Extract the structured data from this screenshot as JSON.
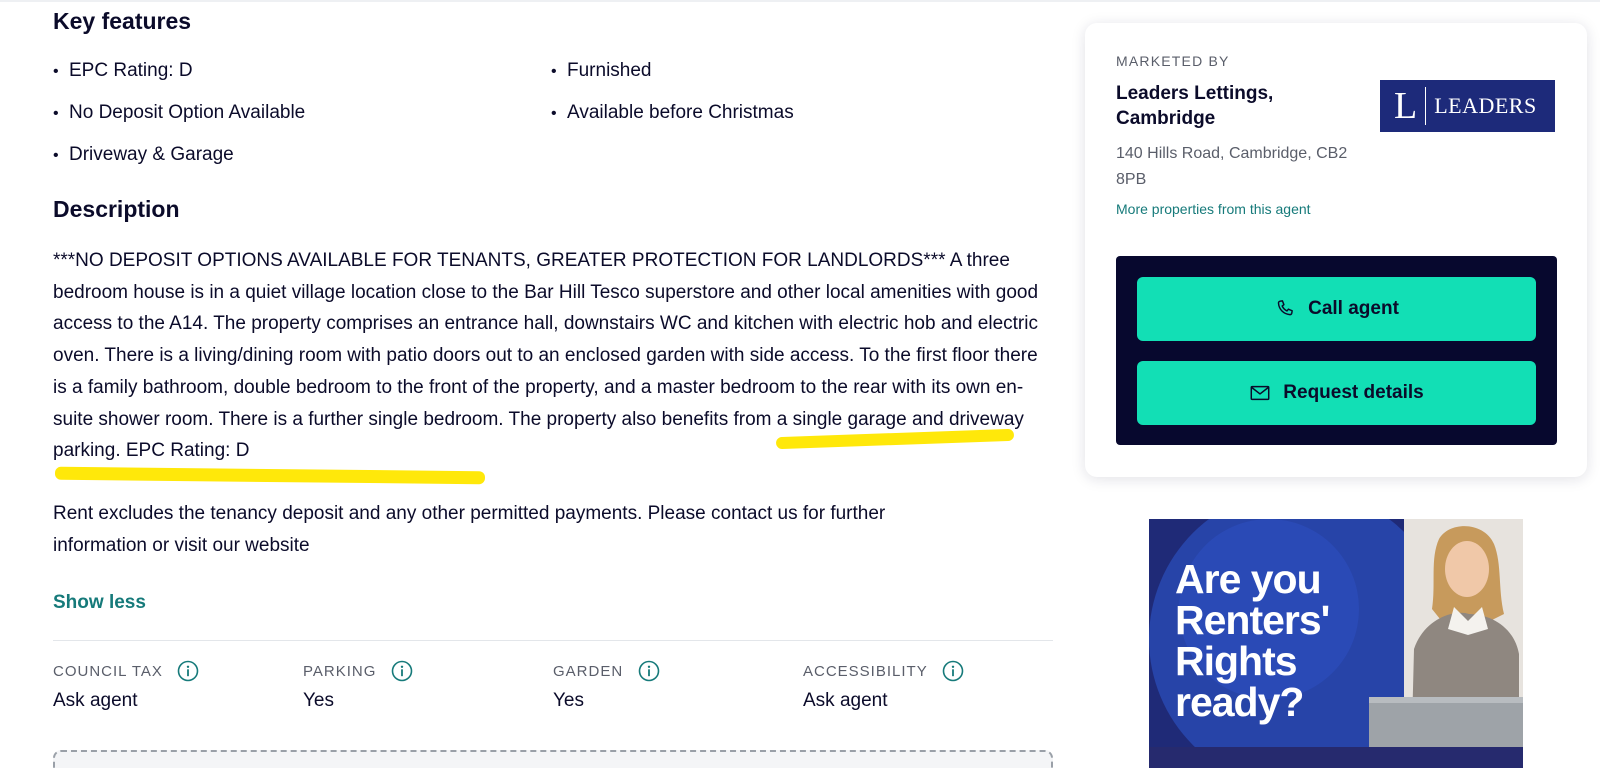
{
  "key_features": {
    "title": "Key features",
    "items": [
      "EPC Rating: D",
      "Furnished",
      "No Deposit Option Available",
      "Available before Christmas",
      "Driveway & Garage"
    ]
  },
  "description": {
    "title": "Description",
    "paragraph1": "***NO DEPOSIT OPTIONS AVAILABLE FOR TENANTS, GREATER PROTECTION FOR LANDLORDS*** A three bedroom house is in a quiet village location close to the Bar Hill Tesco superstore and other local amenities with good access to the A14. The property comprises an entrance hall, downstairs WC and kitchen with electric hob and electric oven. There is a living/dining room with patio doors out to an enclosed garden with side access. To the first floor there is a family bathroom, double bedroom to the front of the property, and a master bedroom to the rear with its own en-suite shower room. There is a further single bedroom. The property also benefits from a single garage and driveway parking. EPC Rating: D",
    "paragraph2": "Rent excludes the tenancy deposit and any other permitted payments. Please contact us for further information or visit our website",
    "show_less": "Show less",
    "highlight_color": "#ffe80a"
  },
  "attributes": [
    {
      "label": "COUNCIL TAX",
      "value": "Ask agent",
      "icon": "info-icon"
    },
    {
      "label": "PARKING",
      "value": "Yes",
      "icon": "info-icon"
    },
    {
      "label": "GARDEN",
      "value": "Yes",
      "icon": "info-icon"
    },
    {
      "label": "ACCESSIBILITY",
      "value": "Ask agent",
      "icon": "info-icon"
    }
  ],
  "agent": {
    "marketed_by": "MARKETED BY",
    "name": "Leaders Lettings, Cambridge",
    "address": "140 Hills Road, Cambridge, CB2 8PB",
    "more_link": "More properties from this agent",
    "logo_letter": "L",
    "logo_word": "LEADERS",
    "call_label": "Call agent",
    "call_icon": "phone-icon",
    "request_label": "Request details",
    "request_icon": "envelope-icon"
  },
  "ad": {
    "headline": "Are you Renters' Rights ready?"
  },
  "colors": {
    "text": "#0b0b2a",
    "accent": "#12dfb5",
    "cta_panel": "#07082e",
    "link": "#167a7a",
    "logo_bg": "#1d2a7a"
  }
}
